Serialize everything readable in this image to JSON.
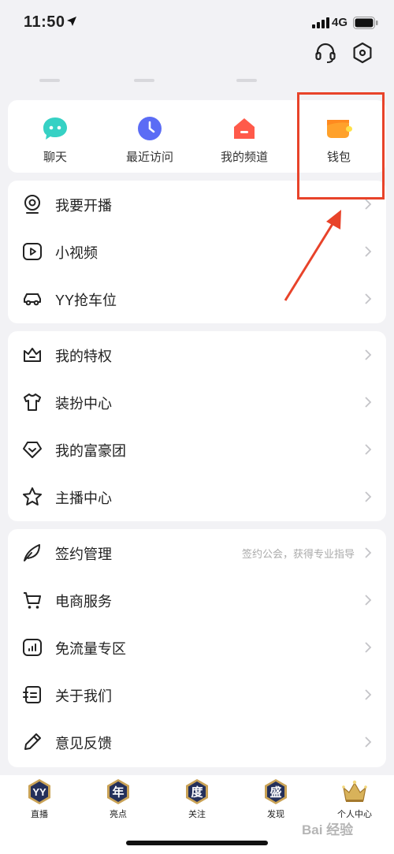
{
  "status_bar": {
    "time": "11:50",
    "network": "4G"
  },
  "quick_actions": [
    {
      "label": "聊天",
      "icon": "chat-bubble-icon",
      "color": "#36d1c4"
    },
    {
      "label": "最近访问",
      "icon": "clock-icon",
      "color": "#5b6cf5"
    },
    {
      "label": "我的频道",
      "icon": "house-icon",
      "color": "#ff5a4a"
    },
    {
      "label": "钱包",
      "icon": "wallet-icon",
      "color": "#ffa12b"
    }
  ],
  "menu_group_1": [
    {
      "label": "我要开播",
      "icon": "webcam-icon"
    },
    {
      "label": "小视频",
      "icon": "video-play-icon"
    },
    {
      "label": "YY抢车位",
      "icon": "car-icon"
    }
  ],
  "menu_group_2": [
    {
      "label": "我的特权",
      "icon": "crown-icon"
    },
    {
      "label": "装扮中心",
      "icon": "tshirt-icon"
    },
    {
      "label": "我的富豪团",
      "icon": "diamond-icon"
    },
    {
      "label": "主播中心",
      "icon": "star-icon"
    }
  ],
  "menu_group_3": [
    {
      "label": "签约管理",
      "icon": "feather-icon",
      "sub": "签约公会，获得专业指导"
    },
    {
      "label": "电商服务",
      "icon": "cart-icon",
      "sub": ""
    },
    {
      "label": "免流量专区",
      "icon": "data-chart-icon",
      "sub": ""
    },
    {
      "label": "关于我们",
      "icon": "info-card-icon",
      "sub": ""
    },
    {
      "label": "意见反馈",
      "icon": "pencil-icon",
      "sub": ""
    }
  ],
  "tab_bar": [
    {
      "label": "直播",
      "glyph": "YY"
    },
    {
      "label": "亮点",
      "glyph": "年"
    },
    {
      "label": "关注",
      "glyph": "度"
    },
    {
      "label": "发现",
      "glyph": "盛"
    },
    {
      "label": "个人中心",
      "glyph": ""
    }
  ],
  "watermark": "Bai 经验",
  "colors": {
    "highlight": "#e8432a",
    "card": "#ffffff",
    "background": "#f2f2f5"
  }
}
